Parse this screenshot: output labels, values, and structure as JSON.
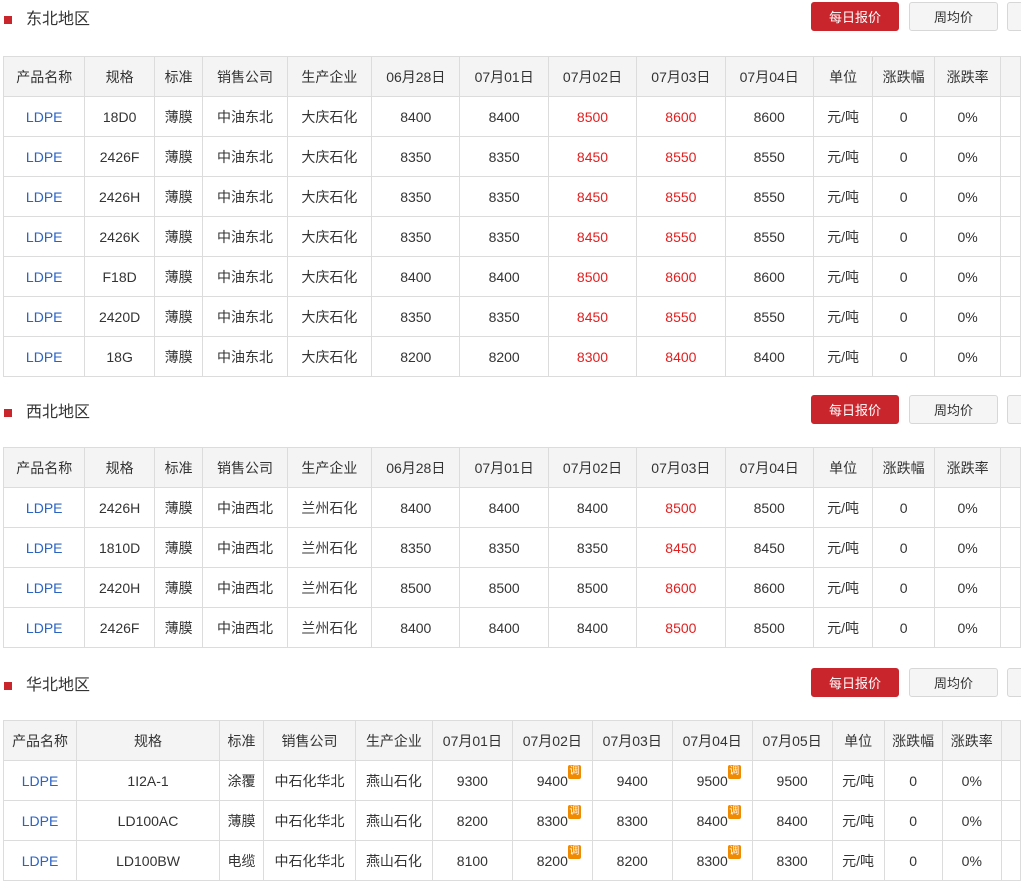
{
  "sections": [
    {
      "title": "东北地区",
      "buttons": {
        "daily": "每日报价",
        "weekly": "周均价"
      },
      "headers": [
        "产品名称",
        "规格",
        "标准",
        "销售公司",
        "生产企业",
        "06月28日",
        "07月01日",
        "07月02日",
        "07月03日",
        "07月04日",
        "单位",
        "涨跌幅",
        "涨跌率"
      ],
      "rows": [
        [
          "LDPE",
          "18D0",
          "薄膜",
          "中油东北",
          "大庆石化",
          "8400",
          "8400",
          "8500",
          "8600",
          "8600",
          "元/吨",
          "0",
          "0%"
        ],
        [
          "LDPE",
          "2426F",
          "薄膜",
          "中油东北",
          "大庆石化",
          "8350",
          "8350",
          "8450",
          "8550",
          "8550",
          "元/吨",
          "0",
          "0%"
        ],
        [
          "LDPE",
          "2426H",
          "薄膜",
          "中油东北",
          "大庆石化",
          "8350",
          "8350",
          "8450",
          "8550",
          "8550",
          "元/吨",
          "0",
          "0%"
        ],
        [
          "LDPE",
          "2426K",
          "薄膜",
          "中油东北",
          "大庆石化",
          "8350",
          "8350",
          "8450",
          "8550",
          "8550",
          "元/吨",
          "0",
          "0%"
        ],
        [
          "LDPE",
          "F18D",
          "薄膜",
          "中油东北",
          "大庆石化",
          "8400",
          "8400",
          "8500",
          "8600",
          "8600",
          "元/吨",
          "0",
          "0%"
        ],
        [
          "LDPE",
          "2420D",
          "薄膜",
          "中油东北",
          "大庆石化",
          "8350",
          "8350",
          "8450",
          "8550",
          "8550",
          "元/吨",
          "0",
          "0%"
        ],
        [
          "LDPE",
          "18G",
          "薄膜",
          "中油东北",
          "大庆石化",
          "8200",
          "8200",
          "8300",
          "8400",
          "8400",
          "元/吨",
          "0",
          "0%"
        ]
      ],
      "up_columns": [
        7,
        8
      ],
      "adjusted": []
    },
    {
      "title": "西北地区",
      "buttons": {
        "daily": "每日报价",
        "weekly": "周均价"
      },
      "headers": [
        "产品名称",
        "规格",
        "标准",
        "销售公司",
        "生产企业",
        "06月28日",
        "07月01日",
        "07月02日",
        "07月03日",
        "07月04日",
        "单位",
        "涨跌幅",
        "涨跌率"
      ],
      "rows": [
        [
          "LDPE",
          "2426H",
          "薄膜",
          "中油西北",
          "兰州石化",
          "8400",
          "8400",
          "8400",
          "8500",
          "8500",
          "元/吨",
          "0",
          "0%"
        ],
        [
          "LDPE",
          "1810D",
          "薄膜",
          "中油西北",
          "兰州石化",
          "8350",
          "8350",
          "8350",
          "8450",
          "8450",
          "元/吨",
          "0",
          "0%"
        ],
        [
          "LDPE",
          "2420H",
          "薄膜",
          "中油西北",
          "兰州石化",
          "8500",
          "8500",
          "8500",
          "8600",
          "8600",
          "元/吨",
          "0",
          "0%"
        ],
        [
          "LDPE",
          "2426F",
          "薄膜",
          "中油西北",
          "兰州石化",
          "8400",
          "8400",
          "8400",
          "8500",
          "8500",
          "元/吨",
          "0",
          "0%"
        ]
      ],
      "up_columns": [
        8
      ],
      "adjusted": []
    },
    {
      "title": "华北地区",
      "buttons": {
        "daily": "每日报价",
        "weekly": "周均价"
      },
      "headers": [
        "产品名称",
        "规格",
        "标准",
        "销售公司",
        "生产企业",
        "07月01日",
        "07月02日",
        "07月03日",
        "07月04日",
        "07月05日",
        "单位",
        "涨跌幅",
        "涨跌率"
      ],
      "rows": [
        [
          "LDPE",
          "1I2A-1",
          "涂覆",
          "中石化华北",
          "燕山石化",
          "9300",
          "9400",
          "9400",
          "9500",
          "9500",
          "元/吨",
          "0",
          "0%"
        ],
        [
          "LDPE",
          "LD100AC",
          "薄膜",
          "中石化华北",
          "燕山石化",
          "8200",
          "8300",
          "8300",
          "8400",
          "8400",
          "元/吨",
          "0",
          "0%"
        ],
        [
          "LDPE",
          "LD100BW",
          "电缆",
          "中石化华北",
          "燕山石化",
          "8100",
          "8200",
          "8200",
          "8300",
          "8300",
          "元/吨",
          "0",
          "0%"
        ]
      ],
      "up_columns": [],
      "adjusted": [
        6,
        8
      ],
      "adjust_label": "调"
    }
  ],
  "colors": {
    "accent": "#c9252d",
    "up": "#e02020",
    "link": "#2a63c4",
    "adjust_badge": "#f08a00"
  }
}
